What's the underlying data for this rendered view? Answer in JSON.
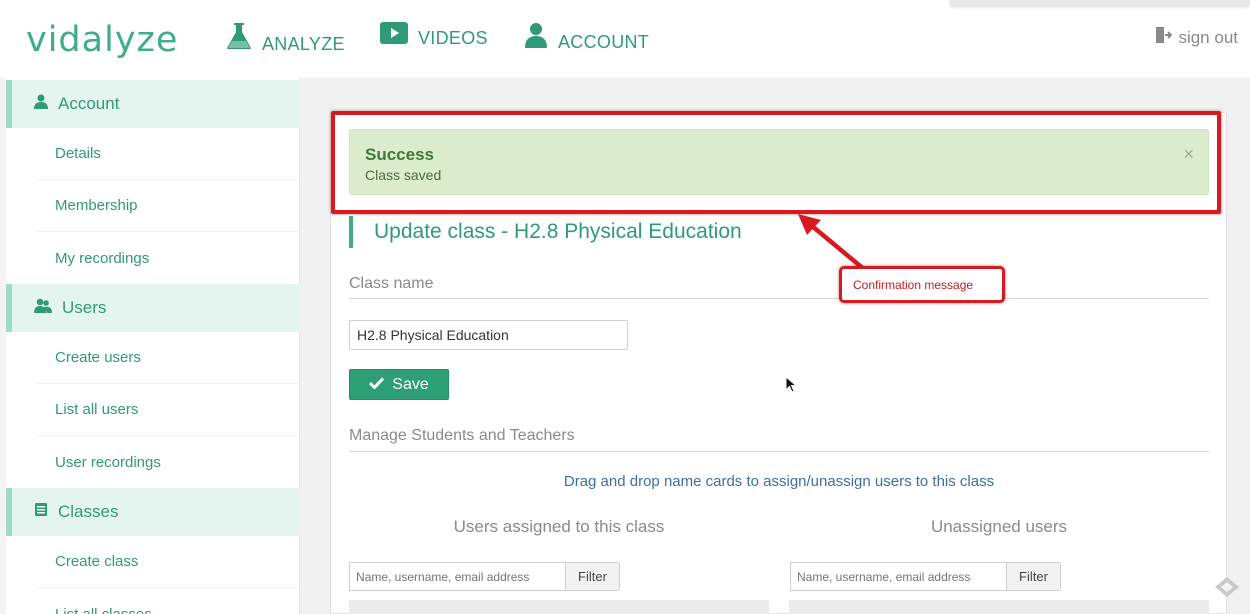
{
  "brand": {
    "logo_text": "vidalyze",
    "accent": "#3fae87"
  },
  "nav": {
    "analyze": {
      "label": "ANALYZE",
      "icon": "flask-icon"
    },
    "videos": {
      "label": "VIDEOS",
      "icon": "video-icon"
    },
    "account": {
      "label": "ACCOUNT",
      "icon": "user-icon"
    },
    "signout": {
      "label": "sign out",
      "icon": "sign-out-icon"
    }
  },
  "sidebar": {
    "sections": [
      {
        "title": "Account",
        "icon": "user-icon",
        "items": [
          "Details",
          "Membership",
          "My recordings"
        ]
      },
      {
        "title": "Users",
        "icon": "users-icon",
        "items": [
          "Create users",
          "List all users",
          "User recordings"
        ]
      },
      {
        "title": "Classes",
        "icon": "book-icon",
        "items": [
          "Create class",
          "List all classes"
        ]
      }
    ]
  },
  "alert": {
    "title": "Success",
    "message": "Class saved",
    "close": "×",
    "color": "#dcedcd"
  },
  "annotation": {
    "callout": "Confirmation message",
    "color": "#d71920"
  },
  "form": {
    "heading": "Update class - H2.8 Physical Education",
    "class_name_label": "Class name",
    "class_name_value": "H2.8 Physical Education",
    "save_label": "Save"
  },
  "manage": {
    "heading": "Manage Students and Teachers",
    "instruction": "Drag and drop name cards to assign/unassign users to this class",
    "assigned": {
      "heading": "Users assigned to this class",
      "placeholder": "Name, username, email address",
      "filter_label": "Filter"
    },
    "unassigned": {
      "heading": "Unassigned users",
      "placeholder": "Name, username, email address",
      "filter_label": "Filter"
    }
  }
}
